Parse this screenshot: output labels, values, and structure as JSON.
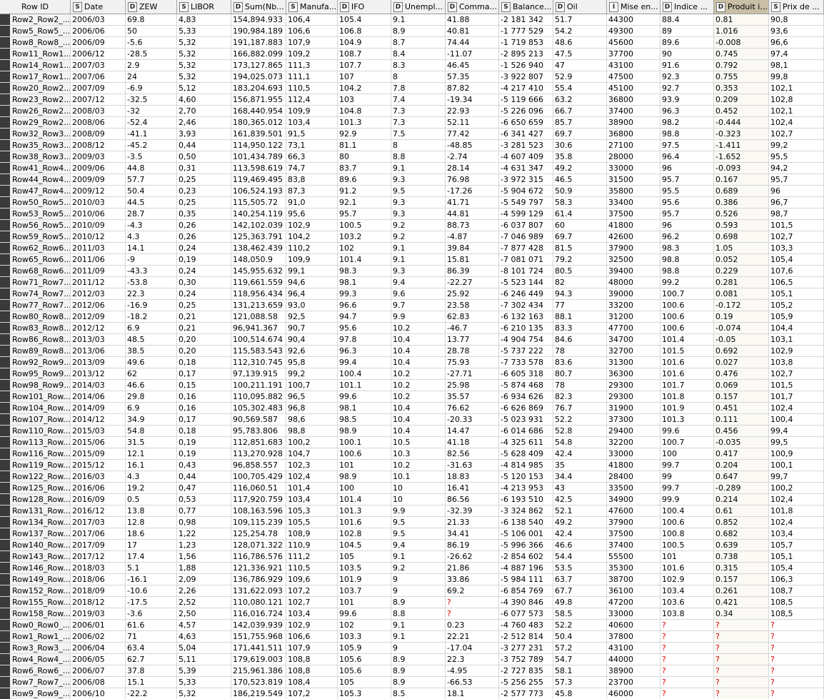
{
  "columns": [
    {
      "type": "",
      "name": "Row ID"
    },
    {
      "type": "S",
      "name": "Date"
    },
    {
      "type": "D",
      "name": "ZEW"
    },
    {
      "type": "S",
      "name": "LIBOR"
    },
    {
      "type": "D",
      "name": "Sum(Nb..."
    },
    {
      "type": "S",
      "name": "Manufa..."
    },
    {
      "type": "D",
      "name": "IFO"
    },
    {
      "type": "D",
      "name": "Unempl..."
    },
    {
      "type": "D",
      "name": "Comma..."
    },
    {
      "type": "S",
      "name": "Balance..."
    },
    {
      "type": "D",
      "name": "Oil"
    },
    {
      "type": "I",
      "name": "Mise en..."
    },
    {
      "type": "D",
      "name": "Indice ..."
    },
    {
      "type": "D",
      "name": "Produit i..."
    },
    {
      "type": "S",
      "name": "Prix de ..."
    }
  ],
  "rows": [
    [
      "Row2_Row2_...",
      "2006/03",
      "69.8",
      "4,83",
      "154,894.933",
      "106,4",
      "105.4",
      "9.1",
      "41.88",
      "-2 181 342",
      "51.7",
      "44300",
      "88.4",
      "0.81",
      "90,8"
    ],
    [
      "Row5_Row5_...",
      "2006/06",
      "50",
      "5,33",
      "190,984.189",
      "106,6",
      "106.8",
      "8.9",
      "40.81",
      "-1 777 529",
      "54.2",
      "49300",
      "89",
      "1.016",
      "93,6"
    ],
    [
      "Row8_Row8_...",
      "2006/09",
      "-5.6",
      "5,32",
      "191,187.883",
      "107,9",
      "104.9",
      "8.7",
      "74.44",
      "-1 719 853",
      "48.6",
      "45600",
      "89.6",
      "-0.008",
      "96,6"
    ],
    [
      "Row11_Row1...",
      "2006/12",
      "-28.5",
      "5,32",
      "166,882.099",
      "109,2",
      "108.7",
      "8.4",
      "-11.07",
      "-2 895 213",
      "47.5",
      "37700",
      "90",
      "0.745",
      "97,4"
    ],
    [
      "Row14_Row1...",
      "2007/03",
      "2.9",
      "5,32",
      "173,127.865",
      "111,3",
      "107.7",
      "8.3",
      "46.45",
      "-1 526 940",
      "47",
      "43100",
      "91.6",
      "0.792",
      "98,1"
    ],
    [
      "Row17_Row1...",
      "2007/06",
      "24",
      "5,32",
      "194,025.073",
      "111,1",
      "107",
      "8",
      "57.35",
      "-3 922 807",
      "52.9",
      "47500",
      "92.3",
      "0.755",
      "99,8"
    ],
    [
      "Row20_Row2...",
      "2007/09",
      "-6.9",
      "5,12",
      "183,204.693",
      "110,5",
      "104.2",
      "7.8",
      "87.82",
      "-4 217 410",
      "55.4",
      "45100",
      "92.7",
      "0.353",
      "102,1"
    ],
    [
      "Row23_Row2...",
      "2007/12",
      "-32.5",
      "4,60",
      "156,871.955",
      "112,4",
      "103",
      "7.4",
      "-19.34",
      "-5 119 666",
      "63.2",
      "36800",
      "93.9",
      "0.209",
      "102,8"
    ],
    [
      "Row26_Row2...",
      "2008/03",
      "-32",
      "2,70",
      "168,440.954",
      "109,9",
      "104.8",
      "7.3",
      "22.93",
      "-5 226 096",
      "66.7",
      "37400",
      "96.3",
      "0.452",
      "102,1"
    ],
    [
      "Row29_Row2...",
      "2008/06",
      "-52.4",
      "2,46",
      "180,365.012",
      "103,4",
      "101.3",
      "7.3",
      "52.11",
      "-6 650 659",
      "85.7",
      "38900",
      "98.2",
      "-0.444",
      "102,4"
    ],
    [
      "Row32_Row3...",
      "2008/09",
      "-41.1",
      "3,93",
      "161,839.501",
      "91,5",
      "92.9",
      "7.5",
      "77.42",
      "-6 341 427",
      "69.7",
      "36800",
      "98.8",
      "-0.323",
      "102,7"
    ],
    [
      "Row35_Row3...",
      "2008/12",
      "-45.2",
      "0,44",
      "114,950.122",
      "73,1",
      "81.1",
      "8",
      "-48.85",
      "-3 281 523",
      "30.6",
      "27100",
      "97.5",
      "-1.411",
      "99,2"
    ],
    [
      "Row38_Row3...",
      "2009/03",
      "-3.5",
      "0,50",
      "101,434.789",
      "66,3",
      "80",
      "8.8",
      "-2.74",
      "-4 607 409",
      "35.8",
      "28000",
      "96.4",
      "-1.652",
      "95,5"
    ],
    [
      "Row41_Row4...",
      "2009/06",
      "44.8",
      "0,31",
      "113,598.619",
      "74,7",
      "83.7",
      "9.1",
      "28.14",
      "-4 631 347",
      "49.2",
      "33000",
      "96",
      "-0.093",
      "94,2"
    ],
    [
      "Row44_Row4...",
      "2009/09",
      "57.7",
      "0,25",
      "119,469.495",
      "83,8",
      "89.6",
      "9.3",
      "76.98",
      "-3 972 315",
      "46.5",
      "31500",
      "95.7",
      "0.167",
      "95,7"
    ],
    [
      "Row47_Row4...",
      "2009/12",
      "50.4",
      "0,23",
      "106,524.193",
      "87,3",
      "91.2",
      "9.5",
      "-17.26",
      "-5 904 672",
      "50.9",
      "35800",
      "95.5",
      "0.689",
      "96"
    ],
    [
      "Row50_Row5...",
      "2010/03",
      "44.5",
      "0,25",
      "115,505.72",
      "91,0",
      "92.1",
      "9.3",
      "41.71",
      "-5 549 797",
      "58.3",
      "33400",
      "95.6",
      "0.386",
      "96,7"
    ],
    [
      "Row53_Row5...",
      "2010/06",
      "28.7",
      "0,35",
      "140,254.119",
      "95,6",
      "95.7",
      "9.3",
      "44.81",
      "-4 599 129",
      "61.4",
      "37500",
      "95.7",
      "0.526",
      "98,7"
    ],
    [
      "Row56_Row5...",
      "2010/09",
      "-4.3",
      "0,26",
      "142,102.039",
      "102,9",
      "100.5",
      "9.2",
      "88.73",
      "-6 037 807",
      "60",
      "41800",
      "96",
      "0.593",
      "101,5"
    ],
    [
      "Row59_Row5...",
      "2010/12",
      "4.3",
      "0,26",
      "125,363.791",
      "104,2",
      "103.2",
      "9.2",
      "-4.87",
      "-7 046 989",
      "69.7",
      "42600",
      "96.2",
      "0.698",
      "102,7"
    ],
    [
      "Row62_Row6...",
      "2011/03",
      "14.1",
      "0,24",
      "138,462.439",
      "110,2",
      "102",
      "9.1",
      "39.84",
      "-7 877 428",
      "81.5",
      "37900",
      "98.3",
      "1.05",
      "103,3"
    ],
    [
      "Row65_Row6...",
      "2011/06",
      "-9",
      "0,19",
      "148,050.9",
      "109,9",
      "101.4",
      "9.1",
      "15.81",
      "-7 081 071",
      "79.2",
      "32500",
      "98.8",
      "0.052",
      "105,4"
    ],
    [
      "Row68_Row6...",
      "2011/09",
      "-43.3",
      "0,24",
      "145,955.632",
      "99,1",
      "98.3",
      "9.3",
      "86.39",
      "-8 101 724",
      "80.5",
      "39400",
      "98.8",
      "0.229",
      "107,6"
    ],
    [
      "Row71_Row7...",
      "2011/12",
      "-53.8",
      "0,30",
      "119,661.559",
      "94,6",
      "98.1",
      "9.4",
      "-22.27",
      "-5 523 144",
      "82",
      "48000",
      "99.2",
      "0.281",
      "106,5"
    ],
    [
      "Row74_Row7...",
      "2012/03",
      "22.3",
      "0,24",
      "118,956.434",
      "96,4",
      "99.3",
      "9.6",
      "25.92",
      "-6 246 449",
      "94.3",
      "39000",
      "100.7",
      "0.081",
      "105,1"
    ],
    [
      "Row77_Row7...",
      "2012/06",
      "-16.9",
      "0,25",
      "131,213.659",
      "93,0",
      "96.6",
      "9.7",
      "23.58",
      "-7 302 434",
      "77",
      "33200",
      "100.6",
      "-0.172",
      "105,2"
    ],
    [
      "Row80_Row8...",
      "2012/09",
      "-18.2",
      "0,21",
      "121,088.58",
      "92,5",
      "94.7",
      "9.9",
      "62.83",
      "-6 132 163",
      "88.1",
      "31200",
      "100.6",
      "0.19",
      "105,9"
    ],
    [
      "Row83_Row8...",
      "2012/12",
      "6.9",
      "0,21",
      "96,941.367",
      "90,7",
      "95.6",
      "10.2",
      "-46.7",
      "-6 210 135",
      "83.3",
      "47700",
      "100.6",
      "-0.074",
      "104,4"
    ],
    [
      "Row86_Row8...",
      "2013/03",
      "48.5",
      "0,20",
      "100,514.674",
      "90,4",
      "97.8",
      "10.4",
      "13.77",
      "-4 904 754",
      "84.6",
      "34700",
      "101.4",
      "-0.05",
      "103,1"
    ],
    [
      "Row89_Row8...",
      "2013/06",
      "38.5",
      "0,20",
      "115,583.543",
      "92,6",
      "96.3",
      "10.4",
      "28.78",
      "-5 737 222",
      "78",
      "32700",
      "101.5",
      "0.692",
      "102,9"
    ],
    [
      "Row92_Row9...",
      "2013/09",
      "49.6",
      "0,18",
      "112,310.745",
      "95,8",
      "99.4",
      "10.4",
      "75.93",
      "-7 733 578",
      "83.6",
      "31300",
      "101.6",
      "0.027",
      "103,8"
    ],
    [
      "Row95_Row9...",
      "2013/12",
      "62",
      "0,17",
      "97,139.915",
      "99,2",
      "100.4",
      "10.2",
      "-27.71",
      "-6 605 318",
      "80.7",
      "36300",
      "101.6",
      "0.476",
      "102,7"
    ],
    [
      "Row98_Row9...",
      "2014/03",
      "46.6",
      "0,15",
      "100,211.191",
      "100,7",
      "101.1",
      "10.2",
      "25.98",
      "-5 874 468",
      "78",
      "29300",
      "101.7",
      "0.069",
      "101,5"
    ],
    [
      "Row101_Row...",
      "2014/06",
      "29.8",
      "0,16",
      "110,095.882",
      "96,5",
      "99.6",
      "10.2",
      "35.57",
      "-6 934 626",
      "82.3",
      "29300",
      "101.8",
      "0.157",
      "101,7"
    ],
    [
      "Row104_Row...",
      "2014/09",
      "6.9",
      "0,16",
      "105,302.483",
      "96,8",
      "98.1",
      "10.4",
      "76.62",
      "-6 626 869",
      "76.7",
      "31900",
      "101.9",
      "0.451",
      "102,4"
    ],
    [
      "Row107_Row...",
      "2014/12",
      "34.9",
      "0,17",
      "90,569.587",
      "98,6",
      "98.5",
      "10.4",
      "-20.33",
      "-5 023 931",
      "52.2",
      "37300",
      "101.3",
      "0.111",
      "100,4"
    ],
    [
      "Row110_Row...",
      "2015/03",
      "54.8",
      "0,18",
      "95,783.806",
      "98,8",
      "98.9",
      "10.4",
      "14.47",
      "-6 014 686",
      "52.8",
      "29400",
      "99.6",
      "0.456",
      "99,4"
    ],
    [
      "Row113_Row...",
      "2015/06",
      "31.5",
      "0,19",
      "112,851.683",
      "100,2",
      "100.1",
      "10.5",
      "41.18",
      "-4 325 611",
      "54.8",
      "32200",
      "100.7",
      "-0.035",
      "99,5"
    ],
    [
      "Row116_Row...",
      "2015/09",
      "12.1",
      "0,19",
      "113,270.928",
      "104,7",
      "100.6",
      "10.3",
      "82.56",
      "-5 628 409",
      "42.4",
      "33000",
      "100",
      "0.417",
      "100,9"
    ],
    [
      "Row119_Row...",
      "2015/12",
      "16.1",
      "0,43",
      "96,858.557",
      "102,3",
      "101",
      "10.2",
      "-31.63",
      "-4 814 985",
      "35",
      "41800",
      "99.7",
      "0.204",
      "100,1"
    ],
    [
      "Row122_Row...",
      "2016/03",
      "4.3",
      "0,44",
      "100,705.429",
      "102,4",
      "98.9",
      "10.1",
      "18.83",
      "-5 120 153",
      "34.4",
      "28400",
      "99",
      "0.647",
      "99,7"
    ],
    [
      "Row125_Row...",
      "2016/06",
      "19.2",
      "0,47",
      "116,060.51",
      "101,4",
      "100",
      "10",
      "16.41",
      "-4 213 953",
      "43",
      "33500",
      "99.7",
      "-0.289",
      "100,2"
    ],
    [
      "Row128_Row...",
      "2016/09",
      "0.5",
      "0,53",
      "117,920.759",
      "103,4",
      "101.4",
      "10",
      "86.56",
      "-6 193 510",
      "42.5",
      "34900",
      "99.9",
      "0.214",
      "102,4"
    ],
    [
      "Row131_Row...",
      "2016/12",
      "13.8",
      "0,77",
      "108,163.596",
      "105,3",
      "101.3",
      "9.9",
      "-32.39",
      "-3 324 862",
      "52.1",
      "47600",
      "100.4",
      "0.61",
      "101,8"
    ],
    [
      "Row134_Row...",
      "2017/03",
      "12.8",
      "0,98",
      "109,115.239",
      "105,5",
      "101.6",
      "9.5",
      "21.33",
      "-6 138 540",
      "49.2",
      "37900",
      "100.6",
      "0.852",
      "102,4"
    ],
    [
      "Row137_Row...",
      "2017/06",
      "18.6",
      "1,22",
      "125,254.78",
      "108,9",
      "102.8",
      "9.5",
      "34.41",
      "-5 106 001",
      "42.4",
      "37500",
      "100.8",
      "0.682",
      "103,4"
    ],
    [
      "Row140_Row...",
      "2017/09",
      "17",
      "1,23",
      "128,071.322",
      "110,9",
      "104.5",
      "9.4",
      "86.19",
      "-5 996 366",
      "46.6",
      "37400",
      "100.5",
      "0.639",
      "105,7"
    ],
    [
      "Row143_Row...",
      "2017/12",
      "17.4",
      "1,56",
      "116,786.576",
      "111,2",
      "105",
      "9.1",
      "-26.62",
      "-2 854 602",
      "54.4",
      "55500",
      "101",
      "0.738",
      "105,1"
    ],
    [
      "Row146_Row...",
      "2018/03",
      "5.1",
      "1,88",
      "121,336.921",
      "110,5",
      "103.5",
      "9.2",
      "21.86",
      "-4 887 196",
      "53.5",
      "35300",
      "101.6",
      "0.315",
      "105,4"
    ],
    [
      "Row149_Row...",
      "2018/06",
      "-16.1",
      "2,09",
      "136,786.929",
      "109,6",
      "101.9",
      "9",
      "33.86",
      "-5 984 111",
      "63.7",
      "38700",
      "102.9",
      "0.157",
      "106,3"
    ],
    [
      "Row152_Row...",
      "2018/09",
      "-10.6",
      "2,26",
      "131,622.093",
      "107,2",
      "103.7",
      "9",
      "69.2",
      "-6 854 769",
      "67.7",
      "36100",
      "103.4",
      "0.261",
      "108,7"
    ],
    [
      "Row155_Row...",
      "2018/12",
      "-17.5",
      "2,52",
      "110,080.121",
      "102,7",
      "101",
      "8.9",
      "?",
      "-4 390 846",
      "49.8",
      "47200",
      "103.6",
      "0.421",
      "108,5"
    ],
    [
      "Row158_Row...",
      "2019/03",
      "-3.6",
      "2,50",
      "116,016.724",
      "103,4",
      "99.6",
      "8.8",
      "?",
      "-6 077 573",
      "58.5",
      "33000",
      "103.8",
      "0.34",
      "108,5"
    ],
    [
      "Row0_Row0_...",
      "2006/01",
      "61.6",
      "4,57",
      "142,039.939",
      "102,9",
      "102",
      "9.1",
      "0.23",
      "-4 760 483",
      "52.2",
      "40600",
      "?",
      "?",
      "?"
    ],
    [
      "Row1_Row1_...",
      "2006/02",
      "71",
      "4,63",
      "151,755.968",
      "106,6",
      "103.3",
      "9.1",
      "22.21",
      "-2 512 814",
      "50.4",
      "37800",
      "?",
      "?",
      "?"
    ],
    [
      "Row3_Row3_...",
      "2006/04",
      "63.4",
      "5,04",
      "171,441.511",
      "107,9",
      "105.9",
      "9",
      "-17.04",
      "-3 277 231",
      "57.2",
      "43100",
      "?",
      "?",
      "?"
    ],
    [
      "Row4_Row4_...",
      "2006/05",
      "62.7",
      "5,11",
      "179,619.003",
      "108,8",
      "105.6",
      "8.9",
      "22.3",
      "-3 752 789",
      "54.7",
      "44000",
      "?",
      "?",
      "?"
    ],
    [
      "Row6_Row6_...",
      "2006/07",
      "37.8",
      "5,39",
      "215,961.386",
      "108,8",
      "105.6",
      "8.9",
      "-4.95",
      "-2 727 835",
      "58.1",
      "38900",
      "?",
      "?",
      "?"
    ],
    [
      "Row7_Row7_...",
      "2006/08",
      "15.1",
      "5,33",
      "170,523.819",
      "108,4",
      "105",
      "8.9",
      "-66.53",
      "-5 256 255",
      "57.3",
      "23700",
      "?",
      "?",
      "?"
    ],
    [
      "Row9_Row9_...",
      "2006/10",
      "-22.2",
      "5,32",
      "186,219.549",
      "107,2",
      "105.3",
      "8.5",
      "18.1",
      "-2 577 773",
      "45.8",
      "46000",
      "?",
      "?",
      "?"
    ]
  ]
}
